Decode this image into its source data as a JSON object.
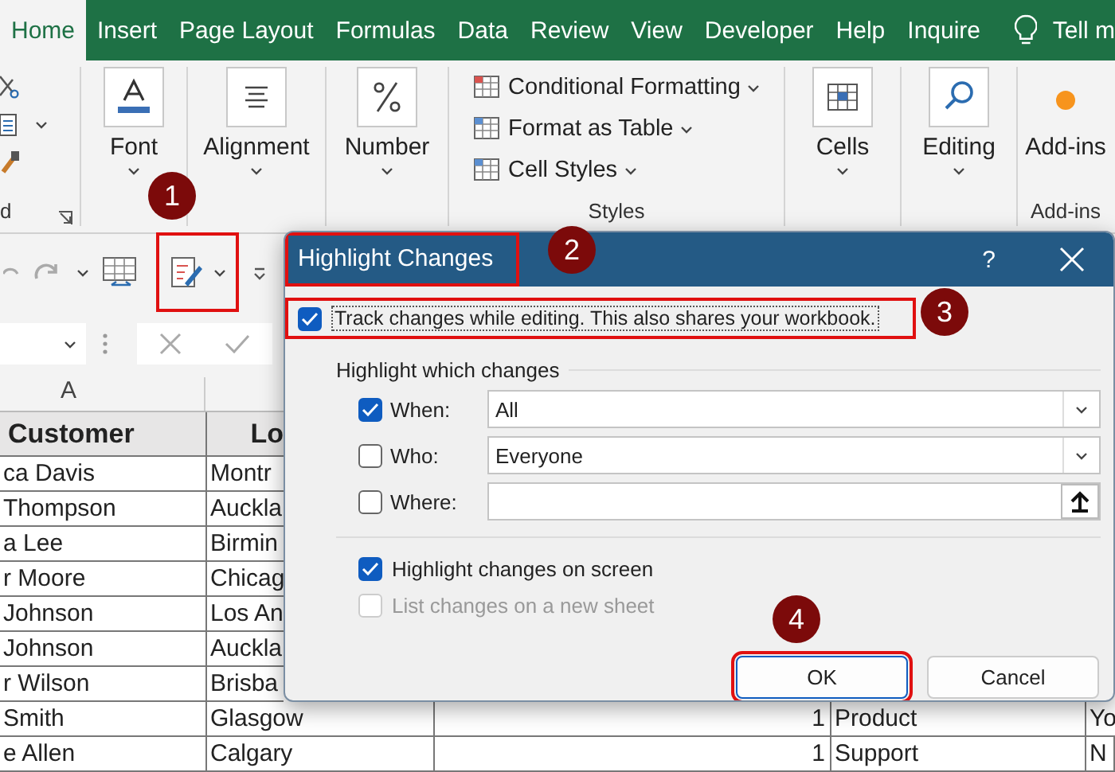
{
  "ribbon_tabs": [
    {
      "label": "Home",
      "selected": true
    },
    {
      "label": "Insert",
      "selected": false
    },
    {
      "label": "Page Layout",
      "selected": false
    },
    {
      "label": "Formulas",
      "selected": false
    },
    {
      "label": "Data",
      "selected": false
    },
    {
      "label": "Review",
      "selected": false
    },
    {
      "label": "View",
      "selected": false
    },
    {
      "label": "Developer",
      "selected": false
    },
    {
      "label": "Help",
      "selected": false
    },
    {
      "label": "Inquire",
      "selected": false
    }
  ],
  "tell_me": "Tell m",
  "ribbon_groups": [
    {
      "kind": "clipboard",
      "label": "d"
    },
    {
      "kind": "font",
      "buttons": [
        "Font"
      ]
    },
    {
      "kind": "alignment",
      "buttons": [
        "Alignment"
      ]
    },
    {
      "kind": "number",
      "buttons": [
        "Number"
      ]
    },
    {
      "kind": "styles",
      "label": "Styles",
      "items": [
        "Conditional Formatting",
        "Format as Table",
        "Cell Styles"
      ]
    },
    {
      "kind": "cells",
      "buttons": [
        "Cells"
      ]
    },
    {
      "kind": "editing",
      "buttons": [
        "Editing"
      ]
    },
    {
      "kind": "addins",
      "label": "Add-ins",
      "buttons": [
        "Add-ins"
      ]
    }
  ],
  "sheet": {
    "column_headers": [
      "A"
    ],
    "header": [
      "Customer",
      "Lo"
    ],
    "rows": [
      [
        "ca Davis",
        "Montr"
      ],
      [
        "Thompson",
        "Auckla"
      ],
      [
        "a Lee",
        "Birmin"
      ],
      [
        "r Moore",
        "Chicag"
      ],
      [
        "Johnson",
        "Los An"
      ],
      [
        "Johnson",
        "Auckla"
      ],
      [
        "r Wilson",
        "Brisba"
      ],
      [
        "Smith",
        "Glasgow",
        "1",
        "Product",
        "Yo"
      ],
      [
        "e Allen",
        "Calgary",
        "1",
        "Support",
        "N"
      ]
    ]
  },
  "dialog": {
    "title": "Highlight Changes",
    "help": "?",
    "track_changes": {
      "label": "Track changes while editing. This also shares your workbook.",
      "checked": true
    },
    "section_title": "Highlight which changes",
    "filters": [
      {
        "kind": "dropdown",
        "label": "When:",
        "checked": true,
        "value": "All"
      },
      {
        "kind": "dropdown",
        "label": "Who:",
        "checked": false,
        "value": "Everyone"
      },
      {
        "kind": "range",
        "label": "Where:",
        "checked": false
      }
    ],
    "options": [
      {
        "label": "Highlight changes on screen",
        "checked": true,
        "disabled": false
      },
      {
        "label": "List changes on a new sheet",
        "checked": false,
        "disabled": true
      }
    ],
    "buttons": [
      {
        "label": "OK",
        "default": true
      },
      {
        "label": "Cancel",
        "default": false
      }
    ]
  },
  "callouts": [
    "1",
    "2",
    "3",
    "4"
  ]
}
